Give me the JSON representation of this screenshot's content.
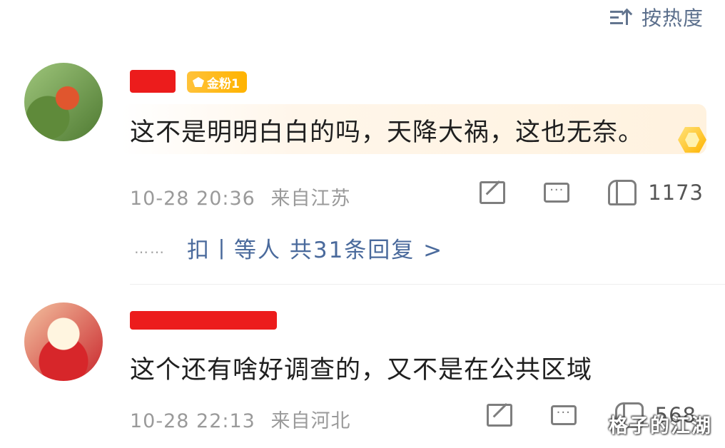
{
  "sort": {
    "label": "按热度",
    "icon": "sort-ascending-icon"
  },
  "comments": [
    {
      "avatar": "avatar-raspberry",
      "username": "",
      "badge": "金粉1",
      "text": "这不是明明白白的吗，天降大祸，这也无奈。",
      "time": "10-28 20:36",
      "location": "来自江苏",
      "likes": "1173",
      "has_gold_medal": true,
      "replies": {
        "dots": "……",
        "text": "扣丨等人 共31条回复 >"
      }
    },
    {
      "avatar": "avatar-lion-dance",
      "username": "",
      "text": "这个还有啥好调查的，又不是在公共区域",
      "time": "10-28 22:13",
      "location": "来自河北",
      "likes": "568"
    }
  ],
  "colors": {
    "link": "#4a6a9c",
    "meta": "#9a9a9a",
    "badge": "#ffb300",
    "redaction": "#ec1c1c"
  },
  "watermark": "格子的江湖"
}
